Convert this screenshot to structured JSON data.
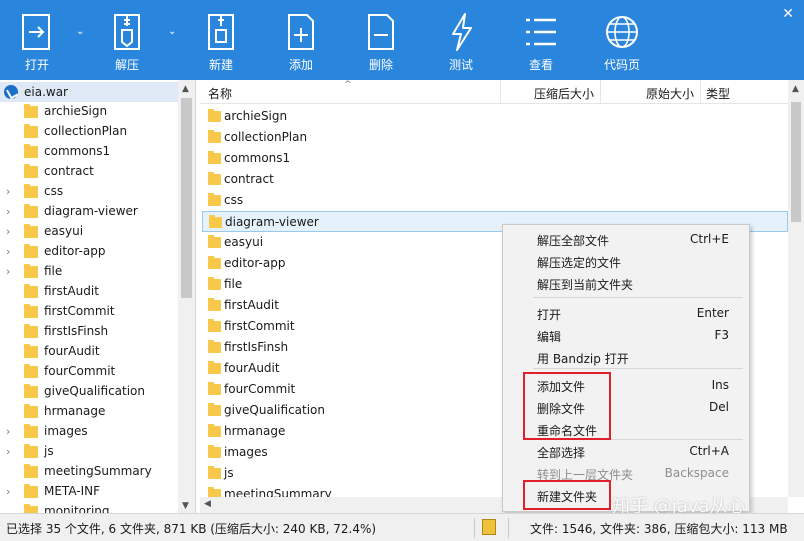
{
  "toolbar": {
    "buttons": [
      {
        "label": "打开",
        "icon": "open-icon"
      },
      {
        "label": "解压",
        "icon": "extract-icon"
      },
      {
        "label": "新建",
        "icon": "new-archive-icon"
      },
      {
        "label": "添加",
        "icon": "add-file-icon"
      },
      {
        "label": "删除",
        "icon": "delete-file-icon"
      },
      {
        "label": "测试",
        "icon": "test-icon"
      },
      {
        "label": "查看",
        "icon": "view-menu-icon"
      },
      {
        "label": "代码页",
        "icon": "globe-icon"
      }
    ],
    "close": "✕"
  },
  "tree": {
    "root": "eia.war",
    "items": [
      {
        "name": "archieSign",
        "expandable": false
      },
      {
        "name": "collectionPlan",
        "expandable": false
      },
      {
        "name": "commons1",
        "expandable": false
      },
      {
        "name": "contract",
        "expandable": false
      },
      {
        "name": "css",
        "expandable": true
      },
      {
        "name": "diagram-viewer",
        "expandable": true
      },
      {
        "name": "easyui",
        "expandable": true
      },
      {
        "name": "editor-app",
        "expandable": true
      },
      {
        "name": "file",
        "expandable": true
      },
      {
        "name": "firstAudit",
        "expandable": false
      },
      {
        "name": "firstCommit",
        "expandable": false
      },
      {
        "name": "firstIsFinsh",
        "expandable": false
      },
      {
        "name": "fourAudit",
        "expandable": false
      },
      {
        "name": "fourCommit",
        "expandable": false
      },
      {
        "name": "giveQualification",
        "expandable": false
      },
      {
        "name": "hrmanage",
        "expandable": false
      },
      {
        "name": "images",
        "expandable": true
      },
      {
        "name": "js",
        "expandable": true
      },
      {
        "name": "meetingSummary",
        "expandable": false
      },
      {
        "name": "META-INF",
        "expandable": true
      },
      {
        "name": "monitoring",
        "expandable": false
      }
    ]
  },
  "list": {
    "columns": {
      "name": "名称",
      "packed": "压缩后大小",
      "original": "原始大小",
      "type": "类型"
    },
    "rows": [
      "archieSign",
      "collectionPlan",
      "commons1",
      "contract",
      "css",
      "diagram-viewer",
      "easyui",
      "editor-app",
      "file",
      "firstAudit",
      "firstCommit",
      "firstIsFinsh",
      "fourAudit",
      "fourCommit",
      "giveQualification",
      "hrmanage",
      "images",
      "js",
      "meetingSummary"
    ],
    "selected_index": 5
  },
  "context_menu": {
    "items": [
      {
        "label": "解压全部文件",
        "shortcut": "Ctrl+E"
      },
      {
        "label": "解压选定的文件",
        "shortcut": ""
      },
      {
        "label": "解压到当前文件夹",
        "shortcut": ""
      },
      {
        "label": "打开",
        "shortcut": "Enter"
      },
      {
        "label": "编辑",
        "shortcut": "F3"
      },
      {
        "label": "用 Bandzip 打开",
        "shortcut": ""
      },
      {
        "label": "添加文件",
        "shortcut": "Ins"
      },
      {
        "label": "删除文件",
        "shortcut": "Del"
      },
      {
        "label": "重命名文件",
        "shortcut": ""
      },
      {
        "label": "全部选择",
        "shortcut": "Ctrl+A"
      },
      {
        "label": "转到上一层文件夹",
        "shortcut": "Backspace",
        "disabled": true
      },
      {
        "label": "新建文件夹",
        "shortcut": ""
      }
    ]
  },
  "status": {
    "left": "已选择 35 个文件, 6 文件夹, 871 KB (压缩后大小: 240 KB, 72.4%)",
    "right": "文件: 1546, 文件夹: 386, 压缩包大小: 113 MB"
  },
  "watermark": "知乎 @java从心",
  "colors": {
    "toolbar": "#2a86dd",
    "highlight": "#e0202a",
    "folder": "#f7c84a"
  }
}
